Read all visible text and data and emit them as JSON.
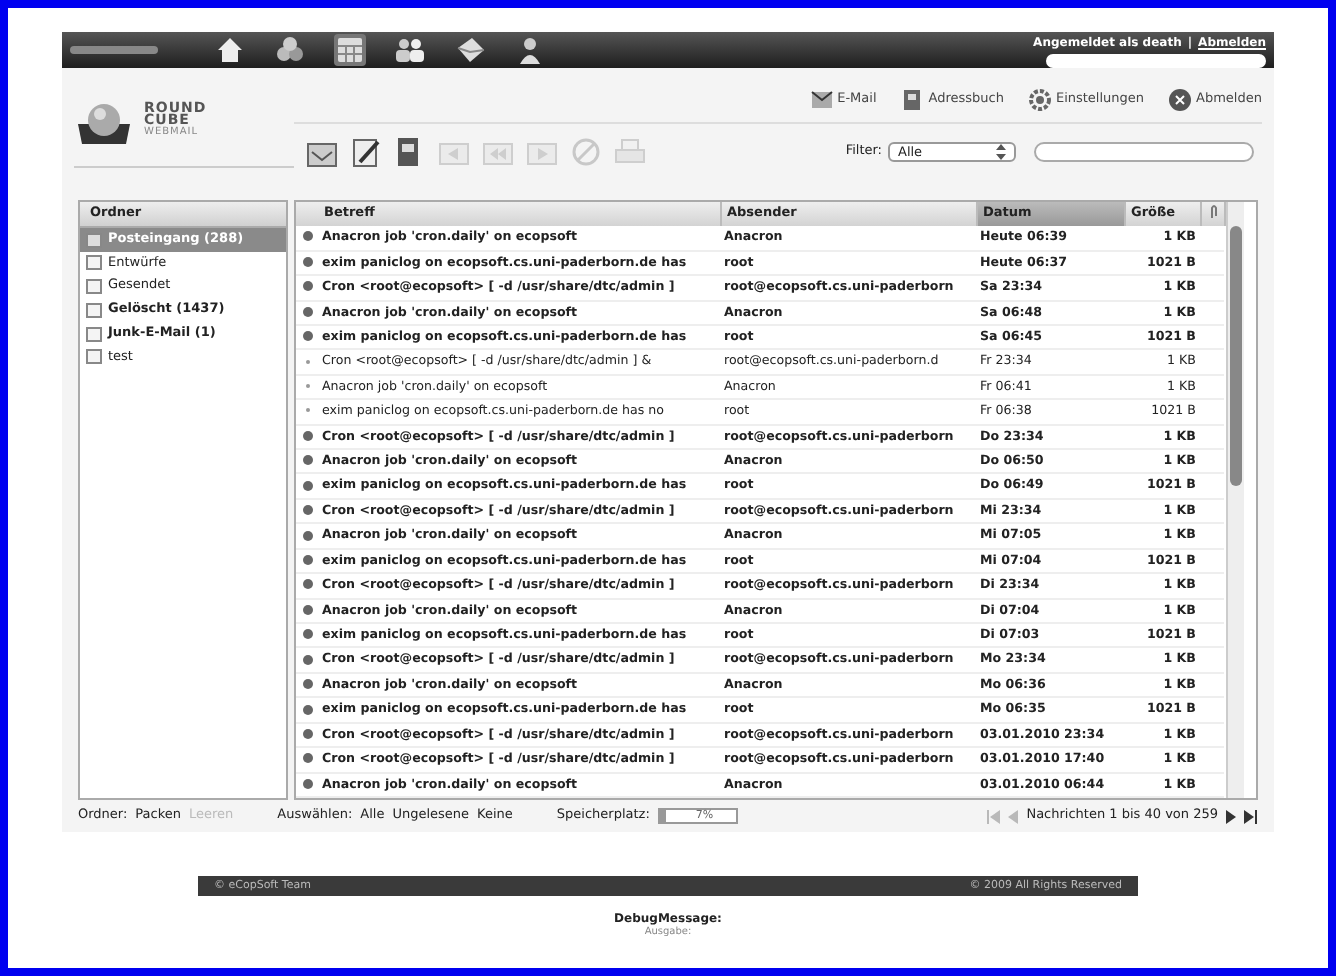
{
  "topbar": {
    "user_info": "Angemeldet als death",
    "separator": "|",
    "logout": "Abmelden",
    "apps": [
      {
        "selected": false
      },
      {
        "selected": false
      },
      {
        "selected": true
      },
      {
        "selected": false
      },
      {
        "selected": false
      },
      {
        "selected": false
      }
    ]
  },
  "logo": {
    "line_1": "ROUND",
    "line_2": "CUBE",
    "line_3": "WEBMAIL"
  },
  "nav": [
    "E-Mail",
    "Adressbuch",
    "Einstellungen",
    "Abmelden"
  ],
  "toolbar": [
    {
      "disabled": false
    },
    {
      "disabled": false
    },
    {
      "disabled": false
    },
    {
      "disabled": true
    },
    {
      "disabled": true
    },
    {
      "disabled": true
    },
    {
      "disabled": true
    },
    {
      "disabled": true
    }
  ],
  "filter": {
    "label": "Filter:",
    "value": "Alle"
  },
  "folders": {
    "title": "Ordner",
    "items": [
      {
        "label": "Posteingang (288)",
        "selected": true,
        "unread": true
      },
      {
        "label": "Entwürfe",
        "selected": false,
        "unread": false
      },
      {
        "label": "Gesendet",
        "selected": false,
        "unread": false
      },
      {
        "label": "Gelöscht (1437)",
        "selected": false,
        "unread": true
      },
      {
        "label": "Junk-E-Mail (1)",
        "selected": false,
        "unread": true
      },
      {
        "label": "test",
        "selected": false,
        "unread": false
      }
    ]
  },
  "table": {
    "columns": [
      {
        "label": "Betreff",
        "sorted": false
      },
      {
        "label": "Absender",
        "sorted": false
      },
      {
        "label": "Datum",
        "sorted": true
      },
      {
        "label": "Größe",
        "sorted": false
      }
    ],
    "rows": [
      {
        "subject": "Anacron job 'cron.daily' on ecopsoft",
        "sender": "Anacron",
        "date": "Heute 06:39",
        "size": "1 KB",
        "unread": true
      },
      {
        "subject": "exim paniclog on ecopsoft.cs.uni-paderborn.de has",
        "sender": "root",
        "date": "Heute 06:37",
        "size": "1021 B",
        "unread": true
      },
      {
        "subject": "Cron <root@ecopsoft> [ -d /usr/share/dtc/admin ]",
        "sender": "root@ecopsoft.cs.uni-paderborn",
        "date": "Sa 23:34",
        "size": "1 KB",
        "unread": true
      },
      {
        "subject": "Anacron job 'cron.daily' on ecopsoft",
        "sender": "Anacron",
        "date": "Sa 06:48",
        "size": "1 KB",
        "unread": true
      },
      {
        "subject": "exim paniclog on ecopsoft.cs.uni-paderborn.de has",
        "sender": "root",
        "date": "Sa 06:45",
        "size": "1021 B",
        "unread": true
      },
      {
        "subject": "Cron <root@ecopsoft> [ -d /usr/share/dtc/admin ] &",
        "sender": "root@ecopsoft.cs.uni-paderborn.d",
        "date": "Fr 23:34",
        "size": "1 KB",
        "unread": false
      },
      {
        "subject": "Anacron job 'cron.daily' on ecopsoft",
        "sender": "Anacron",
        "date": "Fr 06:41",
        "size": "1 KB",
        "unread": false
      },
      {
        "subject": "exim paniclog on ecopsoft.cs.uni-paderborn.de has no",
        "sender": "root",
        "date": "Fr 06:38",
        "size": "1021 B",
        "unread": false
      },
      {
        "subject": "Cron <root@ecopsoft> [ -d /usr/share/dtc/admin ]",
        "sender": "root@ecopsoft.cs.uni-paderborn",
        "date": "Do 23:34",
        "size": "1 KB",
        "unread": true
      },
      {
        "subject": "Anacron job 'cron.daily' on ecopsoft",
        "sender": "Anacron",
        "date": "Do 06:50",
        "size": "1 KB",
        "unread": true
      },
      {
        "subject": "exim paniclog on ecopsoft.cs.uni-paderborn.de has",
        "sender": "root",
        "date": "Do 06:49",
        "size": "1021 B",
        "unread": true
      },
      {
        "subject": "Cron <root@ecopsoft> [ -d /usr/share/dtc/admin ]",
        "sender": "root@ecopsoft.cs.uni-paderborn",
        "date": "Mi 23:34",
        "size": "1 KB",
        "unread": true
      },
      {
        "subject": "Anacron job 'cron.daily' on ecopsoft",
        "sender": "Anacron",
        "date": "Mi 07:05",
        "size": "1 KB",
        "unread": true
      },
      {
        "subject": "exim paniclog on ecopsoft.cs.uni-paderborn.de has",
        "sender": "root",
        "date": "Mi 07:04",
        "size": "1021 B",
        "unread": true
      },
      {
        "subject": "Cron <root@ecopsoft> [ -d /usr/share/dtc/admin ]",
        "sender": "root@ecopsoft.cs.uni-paderborn",
        "date": "Di 23:34",
        "size": "1 KB",
        "unread": true
      },
      {
        "subject": "Anacron job 'cron.daily' on ecopsoft",
        "sender": "Anacron",
        "date": "Di 07:04",
        "size": "1 KB",
        "unread": true
      },
      {
        "subject": "exim paniclog on ecopsoft.cs.uni-paderborn.de has",
        "sender": "root",
        "date": "Di 07:03",
        "size": "1021 B",
        "unread": true
      },
      {
        "subject": "Cron <root@ecopsoft> [ -d /usr/share/dtc/admin ]",
        "sender": "root@ecopsoft.cs.uni-paderborn",
        "date": "Mo 23:34",
        "size": "1 KB",
        "unread": true
      },
      {
        "subject": "Anacron job 'cron.daily' on ecopsoft",
        "sender": "Anacron",
        "date": "Mo 06:36",
        "size": "1 KB",
        "unread": true
      },
      {
        "subject": "exim paniclog on ecopsoft.cs.uni-paderborn.de has",
        "sender": "root",
        "date": "Mo 06:35",
        "size": "1021 B",
        "unread": true
      },
      {
        "subject": "Cron <root@ecopsoft> [ -d /usr/share/dtc/admin ]",
        "sender": "root@ecopsoft.cs.uni-paderborn",
        "date": "03.01.2010 23:34",
        "size": "1 KB",
        "unread": true
      },
      {
        "subject": "Cron <root@ecopsoft> [ -d /usr/share/dtc/admin ]",
        "sender": "root@ecopsoft.cs.uni-paderborn",
        "date": "03.01.2010 17:40",
        "size": "1 KB",
        "unread": true
      },
      {
        "subject": "Anacron job 'cron.daily' on ecopsoft",
        "sender": "Anacron",
        "date": "03.01.2010 06:44",
        "size": "1 KB",
        "unread": true
      }
    ]
  },
  "statusbar": {
    "folder_label": "Ordner:",
    "folder_actions": [
      {
        "label": "Packen",
        "disabled": false
      },
      {
        "label": "Leeren",
        "disabled": true
      }
    ],
    "select_label": "Auswählen:",
    "select_actions": [
      "Alle",
      "Ungelesene",
      "Keine"
    ],
    "quota_label": "Speicherplatz:",
    "quota": {
      "level": 0.07,
      "reading": "7%"
    },
    "pager": {
      "text": "Nachrichten 1 bis 40 von 259",
      "first_disabled": true,
      "prev_disabled": true
    }
  },
  "footer": {
    "left": "© eCopSoft Team",
    "right": "© 2009 All Rights Reserved"
  },
  "debug": {
    "title": "DebugMessage:",
    "output": "Ausgabe:"
  }
}
